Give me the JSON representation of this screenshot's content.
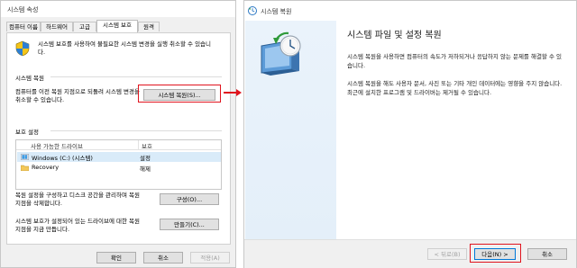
{
  "left_dialog": {
    "title": "시스템 속성",
    "tabs": [
      "컴퓨터 이름",
      "하드웨어",
      "고급",
      "시스템 보호",
      "원격"
    ],
    "active_tab": "시스템 보호",
    "description": "시스템 보호를 사용하여 불필요한 시스템 변경을 실행 취소할 수 있습니다.",
    "restore_group": {
      "label": "시스템 복원",
      "text": "컴퓨터를 이전 복원 지점으로 되돌려 시스템 변경을 취소할 수 있습니다.",
      "button": "시스템 복원(S)..."
    },
    "protection_group": {
      "label": "보호 설정",
      "columns": [
        "사용 가능한 드라이브",
        "보호"
      ],
      "drives": [
        {
          "name": "Windows (C:) (시스템)",
          "protection": "설정",
          "icon": "windows-drive-icon"
        },
        {
          "name": "Recovery",
          "protection": "해제",
          "icon": "folder-drive-icon"
        }
      ]
    },
    "configure_text": "복원 설정을 구성하고 디스크 공간을 관리하며 복원 지점을 삭제합니다.",
    "configure_button": "구성(O)...",
    "create_text": "시스템 보호가 설정되어 있는 드라이브에 대한 복원 지점을 지금 만듭니다.",
    "create_button": "만들기(C)...",
    "ok_button": "확인",
    "cancel_button": "취소",
    "apply_button": "적용(A)"
  },
  "right_dialog": {
    "title": "시스템 복원",
    "heading": "시스템 파일 및 설정 복원",
    "para1": "시스템 복원을 사용하면 컴퓨터의 속도가 저하되거나 응답하지 않는 문제를 해결할 수 있습니다.",
    "para2": "시스템 복원을 해도 사용자 문서, 사진 또는 기타 개인 데이터에는 영향을 주지 않습니다. 최근에 설치한 프로그램 및 드라이버는 제거될 수 있습니다.",
    "back_button": "< 뒤로(B)",
    "next_button": "다음(N) >",
    "cancel_button": "취소"
  },
  "colors": {
    "highlight": "#e0141e",
    "accent": "#0078d7"
  }
}
